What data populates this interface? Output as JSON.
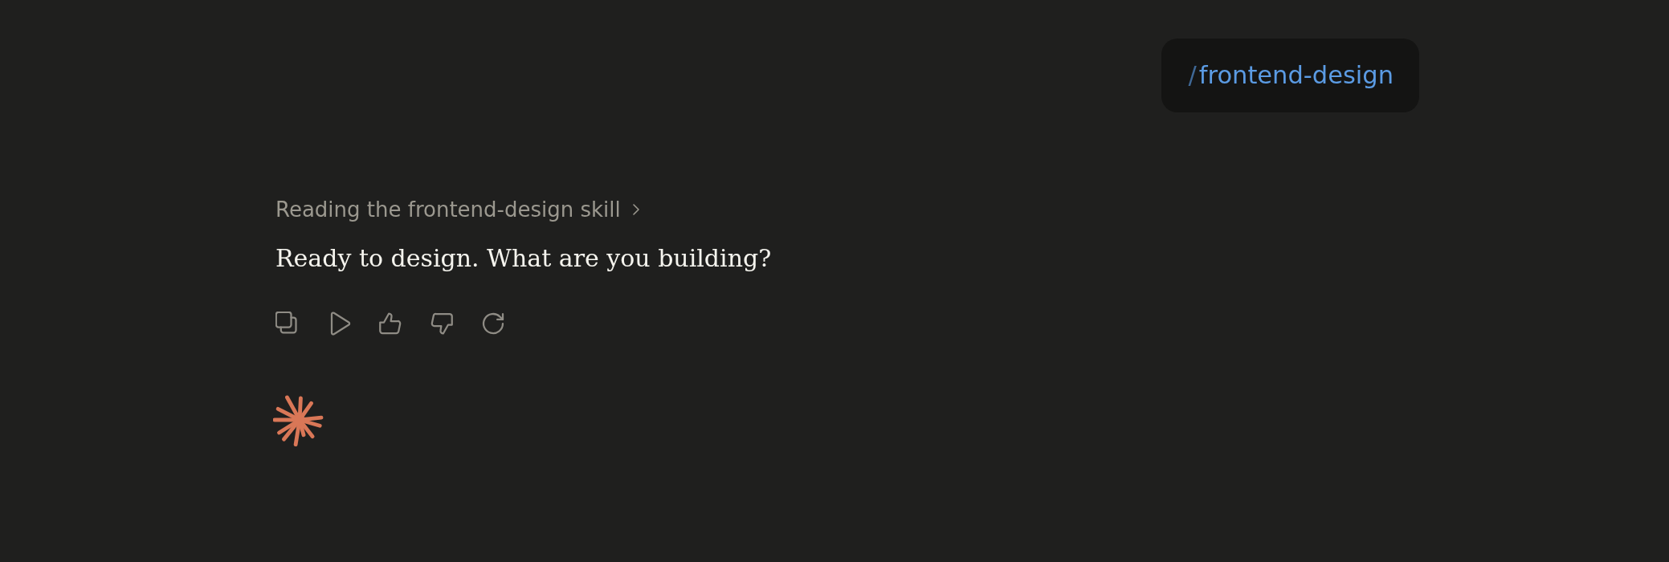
{
  "user_message": {
    "prefix": "/",
    "command": "frontend-design"
  },
  "response": {
    "status": "Reading the frontend-design skill",
    "message": "Ready to design. What are you building?",
    "actions": [
      {
        "kind": "copy"
      },
      {
        "kind": "play"
      },
      {
        "kind": "thumbs_up"
      },
      {
        "kind": "thumbs_down"
      },
      {
        "kind": "retry"
      }
    ]
  }
}
